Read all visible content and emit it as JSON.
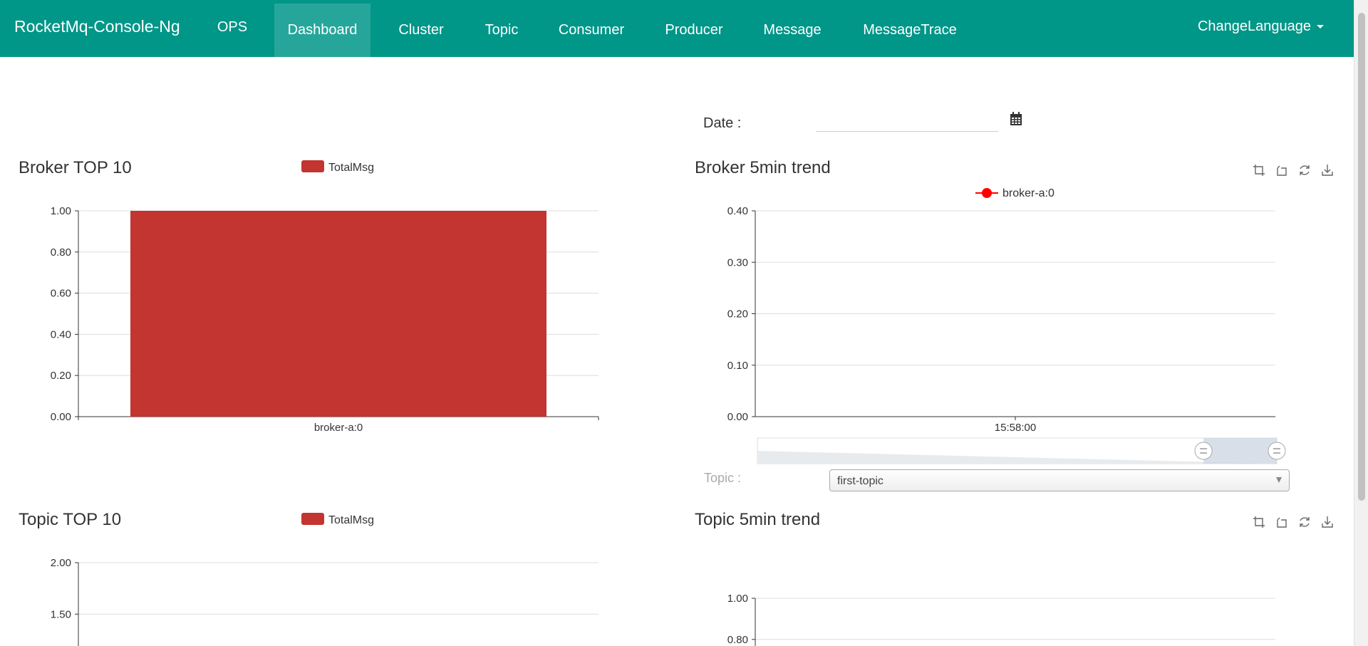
{
  "navbar": {
    "brand": "RocketMq-Console-Ng",
    "items": [
      {
        "label": "OPS"
      },
      {
        "label": "Dashboard"
      },
      {
        "label": "Cluster"
      },
      {
        "label": "Topic"
      },
      {
        "label": "Consumer"
      },
      {
        "label": "Producer"
      },
      {
        "label": "Message"
      },
      {
        "label": "MessageTrace"
      }
    ],
    "active": "Dashboard",
    "language": "ChangeLanguage"
  },
  "colors": {
    "primary": "#009688",
    "active": "#26a69a",
    "bar": "#c23531",
    "series_point": "#ff0000"
  },
  "date": {
    "label": "Date :",
    "value": "",
    "icon": "calendar-icon"
  },
  "topic_filter": {
    "label": "Topic :",
    "selected": "first-topic"
  },
  "toolbox_icons": [
    "zoom-icon",
    "zoom-reset-icon",
    "restore-icon",
    "save-image-icon"
  ],
  "chart_data": [
    {
      "type": "bar",
      "title": "Broker TOP 10",
      "categories": [
        "broker-a:0"
      ],
      "series": [
        {
          "name": "TotalMsg",
          "values": [
            1
          ]
        }
      ],
      "yticks": [
        "0.00",
        "0.20",
        "0.40",
        "0.60",
        "0.80",
        "1.00"
      ],
      "ylim": [
        0,
        1
      ],
      "grid": true,
      "legend": "top-center"
    },
    {
      "type": "line",
      "title": "Broker 5min trend",
      "x": [
        "15:58:00"
      ],
      "series": [
        {
          "name": "broker-a:0",
          "values": [
            0
          ]
        }
      ],
      "yticks": [
        "0.00",
        "0.10",
        "0.20",
        "0.30",
        "0.40"
      ],
      "ylim": [
        0,
        0.4
      ],
      "grid": true,
      "legend": "top-center",
      "data_zoom_percent": [
        90,
        100
      ]
    },
    {
      "type": "bar",
      "title": "Topic TOP 10",
      "categories": [],
      "series": [
        {
          "name": "TotalMsg",
          "values": []
        }
      ],
      "yticks_visible": [
        "2.00",
        "1.50"
      ],
      "ylim": [
        0,
        2
      ],
      "grid": true,
      "legend": "top-center"
    },
    {
      "type": "line",
      "title": "Topic 5min trend",
      "x": [],
      "series": [],
      "yticks_visible": [
        "1.00",
        "0.80"
      ],
      "ylim": [
        0,
        1
      ],
      "grid": true
    }
  ]
}
